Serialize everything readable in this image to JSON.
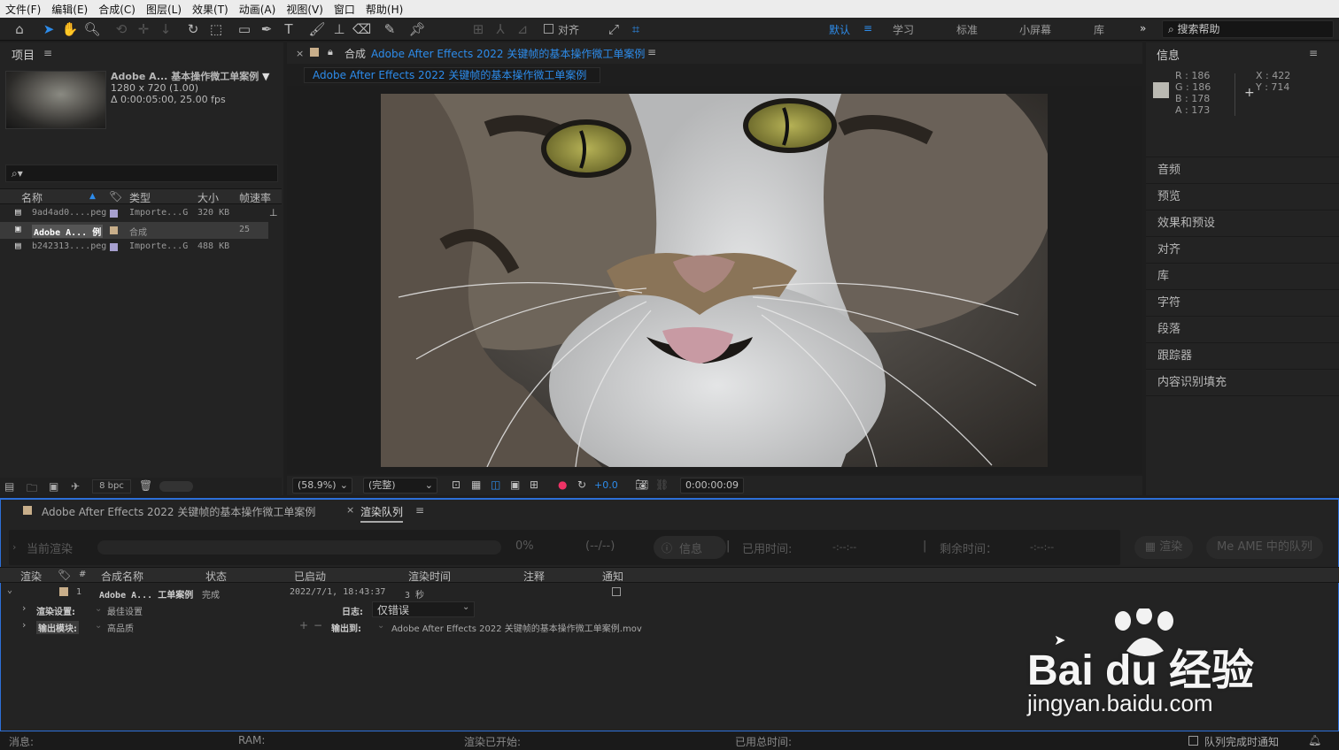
{
  "menu": [
    "文件(F)",
    "编辑(E)",
    "合成(C)",
    "图层(L)",
    "效果(T)",
    "动画(A)",
    "视图(V)",
    "窗口",
    "帮助(H)"
  ],
  "toolbar": {
    "snap_label": "对齐",
    "workspaces": [
      "默认",
      "学习",
      "标准",
      "小屏幕",
      "库"
    ],
    "active_workspace": "默认",
    "help_placeholder": "搜索帮助"
  },
  "project": {
    "title": "项目",
    "comp_name": "Adobe A... 基本操作微工单案例",
    "comp_resolution": "1280 x 720 (1.00)",
    "comp_duration": "Δ 0:00:05:00, 25.00 fps",
    "columns": [
      "名称",
      "类型",
      "大小",
      "帧速率"
    ],
    "items": [
      {
        "name": "9ad4ad0....peg",
        "type": "Importe...G",
        "size": "320 KB",
        "fps": "",
        "color": "#a7a0cf"
      },
      {
        "name": "Adobe A... 例",
        "type": "合成",
        "size": "",
        "fps": "25",
        "color": "#c8ae8a"
      },
      {
        "name": "b242313....peg",
        "type": "Importe...G",
        "size": "488 KB",
        "fps": "",
        "color": "#a7a0cf"
      }
    ],
    "bpc": "8 bpc"
  },
  "composition": {
    "panel_label": "合成",
    "panel_name": "Adobe After Effects 2022 关键帧的基本操作微工单案例",
    "tab_name": "Adobe After Effects 2022 关键帧的基本操作微工单案例",
    "zoom": "(58.9%)",
    "resolution": "(完整)",
    "exposure": "+0.0",
    "timecode": "0:00:00:09"
  },
  "info": {
    "title": "信息",
    "r": "R : 186",
    "g": "G : 186",
    "b": "B : 178",
    "a": "A : 173",
    "x": "X : 422",
    "y": "Y : 714",
    "swatch_color": "#bab9b2",
    "panels": [
      "音频",
      "预览",
      "效果和预设",
      "对齐",
      "库",
      "字符",
      "段落",
      "跟踪器",
      "内容识别填充"
    ]
  },
  "render_queue": {
    "comp_tab": "Adobe After Effects 2022 关键帧的基本操作微工单案例",
    "queue_tab": "渲染队列",
    "current_render": "当前渲染",
    "percent": "0%",
    "frames": "(--/--)",
    "info_btn": "信息",
    "elapsed_label": "已用时间:",
    "elapsed_value": "-:--:--",
    "remaining_label": "剩余时间：",
    "remaining_value": "-:--:--",
    "render_btn": "渲染",
    "ame_btn": "AME 中的队列",
    "columns": [
      "渲染",
      "#",
      "合成名称",
      "状态",
      "已启动",
      "渲染时间",
      "注释",
      "通知"
    ],
    "row": {
      "index": "1",
      "comp": "Adobe A... 工单案例",
      "status": "完成",
      "started": "2022/7/1, 18:43:37",
      "render_time": "3 秒"
    },
    "render_settings_label": "渲染设置:",
    "render_settings_value": "最佳设置",
    "log_label": "日志:",
    "log_value": "仅错误",
    "output_module_label": "输出模块:",
    "output_module_value": "高品质",
    "output_to_label": "输出到:",
    "output_to_value": "Adobe After Effects 2022 关键帧的基本操作微工单案例.mov"
  },
  "status_bar": {
    "message": "消息:",
    "ram": "RAM:",
    "render_started": "渲染已开始:",
    "total_elapsed": "已用总时间:",
    "notify_label": "队列完成时通知"
  },
  "watermark": {
    "brand": "Bai du 经验",
    "url": "jingyan.baidu.com"
  }
}
